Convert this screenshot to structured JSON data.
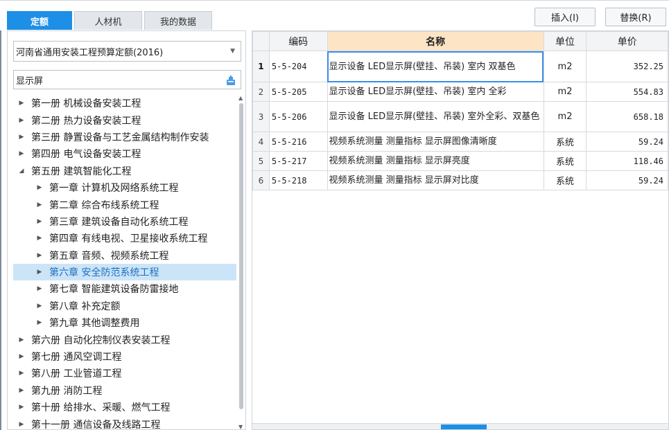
{
  "tabs": [
    {
      "label": "定额",
      "active": true
    },
    {
      "label": "人材机",
      "active": false
    },
    {
      "label": "我的数据",
      "active": false
    }
  ],
  "buttons": {
    "insert": "插入(I)",
    "replace": "替换(R)"
  },
  "left": {
    "library": "河南省通用安装工程预算定额(2016)",
    "search_value": "显示屏",
    "tree": [
      {
        "label": "第一册 机械设备安装工程",
        "level": 0,
        "expanded": false
      },
      {
        "label": "第二册 热力设备安装工程",
        "level": 0,
        "expanded": false
      },
      {
        "label": "第三册 静置设备与工艺金属结构制作安装",
        "level": 0,
        "expanded": false
      },
      {
        "label": "第四册 电气设备安装工程",
        "level": 0,
        "expanded": false
      },
      {
        "label": "第五册 建筑智能化工程",
        "level": 0,
        "expanded": true
      },
      {
        "label": "第一章 计算机及网络系统工程",
        "level": 1,
        "expanded": false
      },
      {
        "label": "第二章 综合布线系统工程",
        "level": 1,
        "expanded": false
      },
      {
        "label": "第三章 建筑设备自动化系统工程",
        "level": 1,
        "expanded": false
      },
      {
        "label": "第四章 有线电视、卫星接收系统工程",
        "level": 1,
        "expanded": false
      },
      {
        "label": "第五章 音频、视频系统工程",
        "level": 1,
        "expanded": false
      },
      {
        "label": "第六章 安全防范系统工程",
        "level": 1,
        "expanded": false,
        "selected": true
      },
      {
        "label": "第七章 智能建筑设备防雷接地",
        "level": 1,
        "expanded": false
      },
      {
        "label": "第八章 补充定额",
        "level": 1,
        "expanded": false
      },
      {
        "label": "第九章 其他调整费用",
        "level": 1,
        "expanded": false
      },
      {
        "label": "第六册 自动化控制仪表安装工程",
        "level": 0,
        "expanded": false
      },
      {
        "label": "第七册 通风空调工程",
        "level": 0,
        "expanded": false
      },
      {
        "label": "第八册 工业管道工程",
        "level": 0,
        "expanded": false
      },
      {
        "label": "第九册 消防工程",
        "level": 0,
        "expanded": false
      },
      {
        "label": "第十册 给排水、采暖、燃气工程",
        "level": 0,
        "expanded": false
      },
      {
        "label": "第十一册 通信设备及线路工程",
        "level": 0,
        "expanded": false
      }
    ]
  },
  "grid": {
    "headers": {
      "code": "编码",
      "name": "名称",
      "unit": "单位",
      "price": "单价"
    },
    "rows": [
      {
        "idx": "1",
        "code": "5-5-204",
        "name": "显示设备 LED显示屏(壁挂、吊装) 室内 双基色",
        "unit": "m2",
        "price": "352.25",
        "current": true
      },
      {
        "idx": "2",
        "code": "5-5-205",
        "name": "显示设备 LED显示屏(壁挂、吊装) 室内 全彩",
        "unit": "m2",
        "price": "554.83"
      },
      {
        "idx": "3",
        "code": "5-5-206",
        "name": "显示设备 LED显示屏(壁挂、吊装) 室外全彩、双基色",
        "unit": "m2",
        "price": "658.18"
      },
      {
        "idx": "4",
        "code": "5-5-216",
        "name": "视频系统测量 测量指标 显示屏图像清晰度",
        "unit": "系统",
        "price": "59.24"
      },
      {
        "idx": "5",
        "code": "5-5-217",
        "name": "视频系统测量 测量指标 显示屏亮度",
        "unit": "系统",
        "price": "118.46"
      },
      {
        "idx": "6",
        "code": "5-5-218",
        "name": "视频系统测量 测量指标 显示屏对比度",
        "unit": "系统",
        "price": "59.24"
      }
    ]
  },
  "colors": {
    "accent": "#1e8fe6",
    "selected_row": "#cce4f7",
    "name_header": "#fde4c5"
  }
}
